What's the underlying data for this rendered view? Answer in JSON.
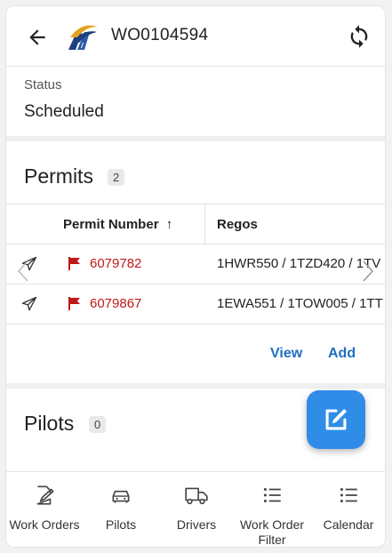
{
  "header": {
    "title": "WO0104594"
  },
  "status": {
    "label": "Status",
    "value": "Scheduled"
  },
  "permits": {
    "title": "Permits",
    "count": "2",
    "columns": {
      "permit_number": "Permit Number",
      "sort_arrow": "↑",
      "regos": "Regos"
    },
    "rows": [
      {
        "permit_number": "6079782",
        "regos": "1HWR550 / 1TZD420 / 1TV"
      },
      {
        "permit_number": "6079867",
        "regos": "1EWA551 / 1TOW005 / 1TT"
      }
    ],
    "actions": {
      "view": "View",
      "add": "Add"
    }
  },
  "pilots": {
    "title": "Pilots",
    "count": "0"
  },
  "bottom_nav": {
    "items": [
      {
        "label": "Work Orders",
        "icon": "edit-document-icon"
      },
      {
        "label": "Pilots",
        "icon": "car-icon"
      },
      {
        "label": "Drivers",
        "icon": "truck-icon"
      },
      {
        "label": "Work Order Filter",
        "icon": "list-icon"
      },
      {
        "label": "Calendar",
        "icon": "list-icon"
      }
    ]
  },
  "colors": {
    "permit_red": "#c01818",
    "accent_blue": "#2f8de8",
    "link_blue": "#1f6fbf"
  }
}
